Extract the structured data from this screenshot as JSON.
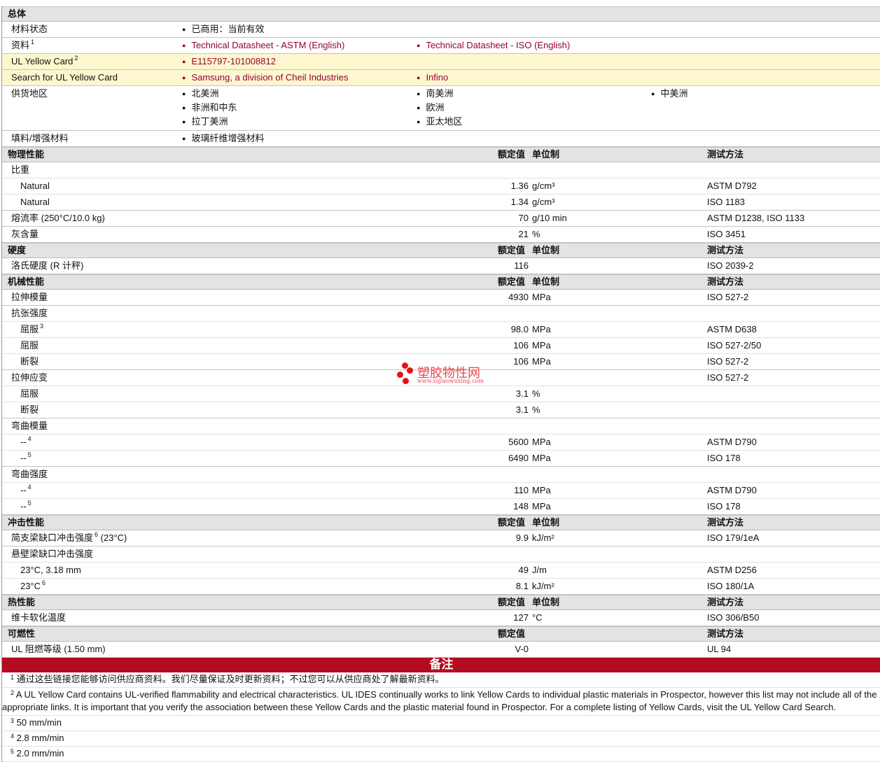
{
  "general": {
    "title": "总体",
    "rows": [
      {
        "label": "材料状态",
        "items": [
          [
            "已商用：当前有效"
          ]
        ],
        "link": false
      },
      {
        "label": "资料",
        "sup": "1",
        "items": [
          [
            "Technical Datasheet - ASTM (English)"
          ],
          [
            "Technical Datasheet - ISO (English)"
          ]
        ],
        "link": true
      },
      {
        "label": "UL Yellow Card",
        "sup": "2",
        "items": [
          [
            "E115797-101008812"
          ]
        ],
        "link": true,
        "yellow": true
      },
      {
        "label": "Search for UL Yellow Card",
        "items": [
          [
            "Samsung, a division of Cheil Industries"
          ],
          [
            "Infino"
          ]
        ],
        "link": true,
        "yellow": true
      },
      {
        "label": "供货地区",
        "items": [
          [
            "北美洲",
            "非洲和中东",
            "拉丁美洲"
          ],
          [
            "南美洲",
            "欧洲",
            "亚太地区"
          ],
          [
            "中美洲"
          ]
        ],
        "link": false
      },
      {
        "label": "填料/增强材料",
        "items": [
          [
            "玻璃纤维增强材料"
          ]
        ],
        "link": false
      }
    ]
  },
  "columns": {
    "rated": "额定值",
    "unit": "单位制",
    "method": "测试方法"
  },
  "rows": [
    {
      "h": "物理性能",
      "unit": true
    },
    {
      "label": "比重"
    },
    {
      "label": "Natural",
      "ind": true,
      "value": "1.36",
      "unit": "g/cm³",
      "method": "ASTM D792"
    },
    {
      "label": "Natural",
      "ind": true,
      "value": "1.34",
      "unit": "g/cm³",
      "method": "ISO 1183",
      "major": true
    },
    {
      "label": "熔流率",
      "suffix": "(250°C/10.0 kg)",
      "value": "70",
      "unit": "g/10 min",
      "method": "ASTM D1238, ISO 1133",
      "major": true
    },
    {
      "label": "灰含量",
      "value": "21",
      "unit": "%",
      "method": "ISO 3451",
      "major": true
    },
    {
      "h": "硬度",
      "unit": true
    },
    {
      "label": "洛氏硬度",
      "suffix": "(R 计秤)",
      "value": "116",
      "unit": "",
      "method": "ISO 2039-2",
      "major": true
    },
    {
      "h": "机械性能",
      "unit": true
    },
    {
      "label": "拉伸模量",
      "value": "4930",
      "unit": "MPa",
      "method": "ISO 527-2",
      "major": true
    },
    {
      "label": "抗张强度"
    },
    {
      "label": "屈服",
      "sup": "3",
      "ind": true,
      "value": "98.0",
      "unit": "MPa",
      "method": "ASTM D638"
    },
    {
      "label": "屈服",
      "ind": true,
      "value": "106",
      "unit": "MPa",
      "method": "ISO 527-2/50"
    },
    {
      "label": "断裂",
      "ind": true,
      "value": "106",
      "unit": "MPa",
      "method": "ISO 527-2",
      "major": true
    },
    {
      "label": "拉伸应变",
      "method": "ISO 527-2"
    },
    {
      "label": "屈服",
      "ind": true,
      "value": "3.1",
      "unit": "%"
    },
    {
      "label": "断裂",
      "ind": true,
      "value": "3.1",
      "unit": "%",
      "major": true
    },
    {
      "label": "弯曲模量"
    },
    {
      "label": "--",
      "sup": "4",
      "ind": true,
      "value": "5600",
      "unit": "MPa",
      "method": "ASTM D790"
    },
    {
      "label": "--",
      "sup": "5",
      "ind": true,
      "value": "6490",
      "unit": "MPa",
      "method": "ISO 178",
      "major": true
    },
    {
      "label": "弯曲强度"
    },
    {
      "label": "--",
      "sup": "4",
      "ind": true,
      "value": "110",
      "unit": "MPa",
      "method": "ASTM D790"
    },
    {
      "label": "--",
      "sup": "5",
      "ind": true,
      "value": "148",
      "unit": "MPa",
      "method": "ISO 178",
      "major": true
    },
    {
      "h": "冲击性能",
      "unit": true
    },
    {
      "label": "简支梁缺口冲击强度",
      "sup": "6",
      "suffix": "(23°C)",
      "value": "9.9",
      "unit": "kJ/m²",
      "method": "ISO 179/1eA",
      "major": true
    },
    {
      "label": "悬壁梁缺口冲击强度"
    },
    {
      "label": "23°C, 3.18 mm",
      "ind": true,
      "value": "49",
      "unit": "J/m",
      "method": "ASTM D256"
    },
    {
      "label": "23°C",
      "sup": "6",
      "ind": true,
      "value": "8.1",
      "unit": "kJ/m²",
      "method": "ISO 180/1A",
      "major": true
    },
    {
      "h": "热性能",
      "unit": true
    },
    {
      "label": "维卡软化温度",
      "value": "127",
      "unit": "°C",
      "method": "ISO 306/B50",
      "major": true
    },
    {
      "h": "可燃性",
      "unit": false
    },
    {
      "label": "UL 阻燃等级",
      "suffix": "(1.50 mm)",
      "value": "V-0",
      "unit": "",
      "method": "UL 94",
      "major": true
    }
  ],
  "notes": {
    "title": "备注",
    "items": [
      {
        "n": "1",
        "text": "通过这些链接您能够访问供应商资料。我们尽量保证及时更新资料；不过您可以从供应商处了解最新资料。"
      },
      {
        "n": "2",
        "text": "A UL Yellow Card contains UL-verified flammability and electrical characteristics. UL IDES continually works to link Yellow Cards to individual plastic materials in Prospector, however this list may not include all of the appropriate links. It is important that you verify the association between these Yellow Cards and the plastic material found in Prospector. For a complete listing of Yellow Cards, visit the UL Yellow Card Search."
      },
      {
        "n": "3",
        "text": "50 mm/min"
      },
      {
        "n": "4",
        "text": "2.8 mm/min"
      },
      {
        "n": "5",
        "text": "2.0 mm/min"
      }
    ]
  },
  "watermark": {
    "cn": "塑胶物性网",
    "url": "www.sujiaowuxing.com"
  }
}
